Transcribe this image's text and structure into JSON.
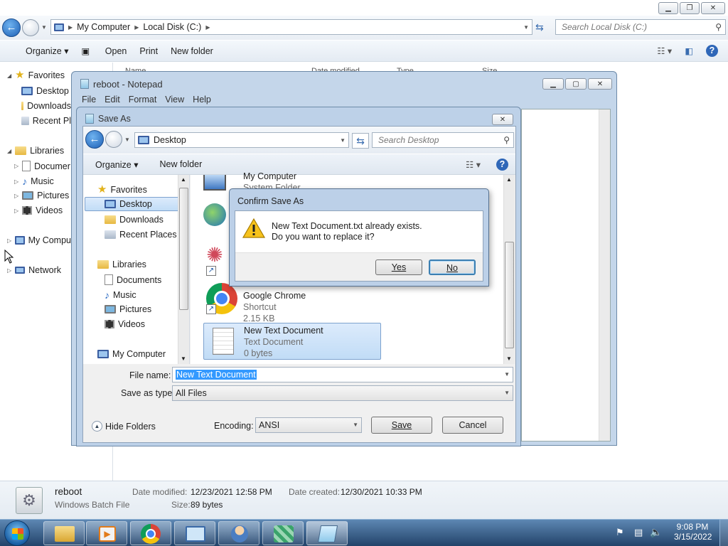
{
  "explorer": {
    "address": [
      "My Computer",
      "Local Disk (C:)"
    ],
    "search_placeholder": "Search Local Disk (C:)",
    "toolbar": {
      "organize": "Organize",
      "open": "Open",
      "print": "Print",
      "new_folder": "New folder"
    },
    "nav": {
      "favorites": "Favorites",
      "desktop": "Desktop",
      "downloads": "Downloads",
      "recent": "Recent Pl",
      "libraries": "Libraries",
      "documents": "Documer",
      "music": "Music",
      "pictures": "Pictures",
      "videos": "Videos",
      "my_computer": "My Compu",
      "network": "Network"
    },
    "columns": [
      "Name",
      "Date modified",
      "Type",
      "Size"
    ],
    "status": {
      "name": "reboot",
      "type": "Windows Batch File",
      "modified_label": "Date modified:",
      "modified": "12/23/2021 12:58 PM",
      "created_label": "Date created:",
      "created": "12/30/2021 10:33 PM",
      "size_label": "Size:",
      "size": "89 bytes"
    }
  },
  "notepad": {
    "title": "reboot - Notepad",
    "menu": [
      "File",
      "Edit",
      "Format",
      "View",
      "Help"
    ]
  },
  "saveas": {
    "title": "Save As",
    "location": "Desktop",
    "search_placeholder": "Search Desktop",
    "organize": "Organize",
    "new_folder": "New folder",
    "nav": {
      "favorites": "Favorites",
      "desktop": "Desktop",
      "downloads": "Downloads",
      "recent": "Recent Places",
      "libraries": "Libraries",
      "documents": "Documents",
      "music": "Music",
      "pictures": "Pictures",
      "videos": "Videos",
      "my_computer": "My Computer"
    },
    "files": [
      {
        "name": "My Computer",
        "sub1": "System Folder"
      },
      {
        "name": "Google Chrome",
        "sub1": "Shortcut",
        "sub2": "2.15 KB"
      },
      {
        "name": "New Text Document",
        "sub1": "Text Document",
        "sub2": "0 bytes"
      }
    ],
    "file_name_label": "File name:",
    "file_name": "New Text Document",
    "save_type_label": "Save as type:",
    "save_type": "All Files",
    "hide_folders": "Hide Folders",
    "encoding_label": "Encoding:",
    "encoding": "ANSI",
    "save": "Save",
    "cancel": "Cancel"
  },
  "confirm": {
    "title": "Confirm Save As",
    "line1": "New Text Document.txt already exists.",
    "line2": "Do you want to replace it?",
    "yes": "Yes",
    "no": "No"
  },
  "taskbar": {
    "time": "9:08 PM",
    "date": "3/15/2022"
  },
  "colors": {
    "accent": "#3399ff",
    "selection": "#cce4f7",
    "taskbar": "#2b4f7a"
  }
}
